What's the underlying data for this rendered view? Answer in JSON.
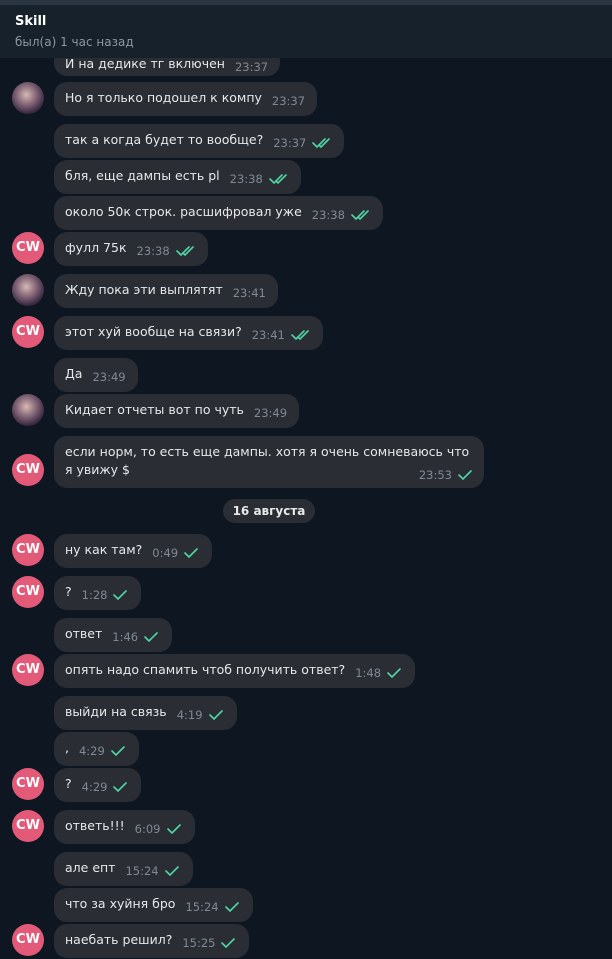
{
  "header": {
    "title": "Skill",
    "status": "был(а) 1 час назад"
  },
  "date_separator": "16 августа",
  "avatar_cw_label": "CW",
  "accent_check_color": "#4fd6a6",
  "messages": [
    {
      "text": "И на дедике тг включен",
      "time": "23:37",
      "direction": "in"
    },
    {
      "text": "Но я только подошел к компу",
      "time": "23:37",
      "direction": "in"
    },
    {
      "text": "так а когда будет то вообще?",
      "time": "23:37",
      "direction": "out",
      "status": "read"
    },
    {
      "text": "бля, еще дампы есть pl",
      "time": "23:38",
      "direction": "out",
      "status": "read"
    },
    {
      "text": "около 50к строк. расшифровал уже",
      "time": "23:38",
      "direction": "out",
      "status": "read"
    },
    {
      "text": "фулл 75к",
      "time": "23:38",
      "direction": "out",
      "status": "read"
    },
    {
      "text": "Жду пока эти выплятят",
      "time": "23:41",
      "direction": "in"
    },
    {
      "text": "этот хуй вообще на связи?",
      "time": "23:41",
      "direction": "out",
      "status": "read"
    },
    {
      "text": "Да",
      "time": "23:49",
      "direction": "in"
    },
    {
      "text": "Кидает отчеты вот по чуть",
      "time": "23:49",
      "direction": "in"
    },
    {
      "text": "если норм, то есть еще дампы. хотя я очень сомневаюсь что я увижу $",
      "time": "23:53",
      "direction": "out",
      "status": "sent"
    },
    {
      "text": "ну как там?",
      "time": "0:49",
      "direction": "out",
      "status": "sent"
    },
    {
      "text": "?",
      "time": "1:28",
      "direction": "out",
      "status": "sent"
    },
    {
      "text": "ответ",
      "time": "1:46",
      "direction": "out",
      "status": "sent"
    },
    {
      "text": "опять надо спамить чтоб получить ответ?",
      "time": "1:48",
      "direction": "out",
      "status": "sent"
    },
    {
      "text": "выйди на связь",
      "time": "4:19",
      "direction": "out",
      "status": "sent"
    },
    {
      "text": ",",
      "time": "4:29",
      "direction": "out",
      "status": "sent"
    },
    {
      "text": "?",
      "time": "4:29",
      "direction": "out",
      "status": "sent"
    },
    {
      "text": "ответь!!!",
      "time": "6:09",
      "direction": "out",
      "status": "sent"
    },
    {
      "text": "але епт",
      "time": "15:24",
      "direction": "out",
      "status": "sent"
    },
    {
      "text": "что за хуйня бро",
      "time": "15:24",
      "direction": "out",
      "status": "sent"
    },
    {
      "text": "наебать решил?",
      "time": "15:25",
      "direction": "out",
      "status": "sent"
    }
  ]
}
